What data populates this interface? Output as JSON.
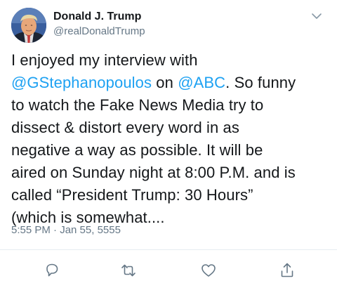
{
  "author": {
    "display_name": "Donald J. Trump",
    "handle": "@realDonaldTrump",
    "avatar_icon": "profile-photo"
  },
  "tweet": {
    "lines": [
      [
        {
          "text": "I enjoyed my interview with",
          "mention": false
        }
      ],
      [
        {
          "text": "@GStephanopoulos",
          "mention": true
        },
        {
          "text": " on ",
          "mention": false
        },
        {
          "text": "@ABC",
          "mention": true
        },
        {
          "text": ". So funny",
          "mention": false
        }
      ],
      [
        {
          "text": "to watch the Fake News Media try to",
          "mention": false
        }
      ],
      [
        {
          "text": "dissect & distort every word in as",
          "mention": false
        }
      ],
      [
        {
          "text": "negative a way as possible. It will be",
          "mention": false
        }
      ],
      [
        {
          "text": "aired on Sunday night at 8:00 P.M. and is",
          "mention": false
        }
      ],
      [
        {
          "text": "called “President Trump: 30 Hours”",
          "mention": false
        }
      ],
      [
        {
          "text": "(which is somewhat....",
          "mention": false
        }
      ]
    ],
    "timestamp": "5:55 PM · Jan 55, 5555"
  },
  "actions": [
    {
      "name": "reply",
      "icon": "reply-icon"
    },
    {
      "name": "retweet",
      "icon": "retweet-icon"
    },
    {
      "name": "like",
      "icon": "heart-icon"
    },
    {
      "name": "share",
      "icon": "share-icon"
    }
  ],
  "colors": {
    "text": "#14171a",
    "secondary": "#657786",
    "mention": "#1da1f2",
    "divider": "#e6ecf0"
  }
}
